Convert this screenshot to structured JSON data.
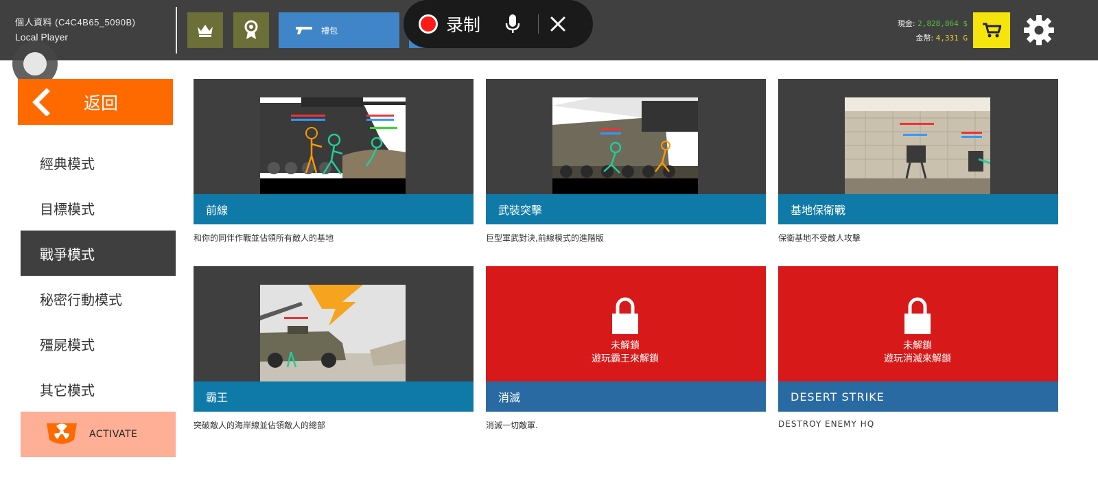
{
  "profile": {
    "name": "個人資料 (C4C4B65_5090B)",
    "player": "Local Player"
  },
  "tabs": {
    "bag_label": "禮包"
  },
  "recorder": {
    "label": "录制"
  },
  "currency": {
    "cash_label": "現金:",
    "cash_value": "2,828,864 $",
    "gold_label": "金幣:",
    "gold_value": "4,331 G"
  },
  "sidebar": {
    "back_label": "返回",
    "items": [
      {
        "label": "經典模式"
      },
      {
        "label": "目標模式"
      },
      {
        "label": "戰爭模式"
      },
      {
        "label": "秘密行動模式"
      },
      {
        "label": "殭屍模式"
      },
      {
        "label": "其它模式"
      }
    ],
    "activate_label": "ACTIVATE"
  },
  "modes": [
    {
      "title": "前線",
      "desc": "和你的同伴作戰並佔領所有敵人的基地"
    },
    {
      "title": "武裝突擊",
      "desc": "巨型軍武對決,前線模式的進階版"
    },
    {
      "title": "基地保衛戰",
      "desc": "保衛基地不受敵人攻擊"
    },
    {
      "title": "霸王",
      "desc": "突破敵人的海岸線並佔領敵人的總部"
    },
    {
      "title": "消滅",
      "desc": "消滅一切敵軍.",
      "lock_line1": "未解鎖",
      "lock_line2": "遊玩霸王來解鎖"
    },
    {
      "title": "DESERT STRIKE",
      "desc": "DESTROY ENEMY HQ",
      "lock_line1": "未解鎖",
      "lock_line2": "遊玩消滅來解鎖"
    }
  ],
  "colors": {
    "topbar": "#404040",
    "back_button": "#ff6a00",
    "active_item": "#3f3f3f",
    "card_bar": "#0f7aa8",
    "locked_panel": "#d81919",
    "cart_button": "#f6e50c",
    "activate_bg": "#ffaf95"
  },
  "icons": [
    "crown-icon",
    "medal-icon",
    "gun-icon",
    "mic-icon",
    "close-icon",
    "cart-icon",
    "gear-icon",
    "chevron-left-icon",
    "radiation-icon",
    "lock-icon"
  ]
}
